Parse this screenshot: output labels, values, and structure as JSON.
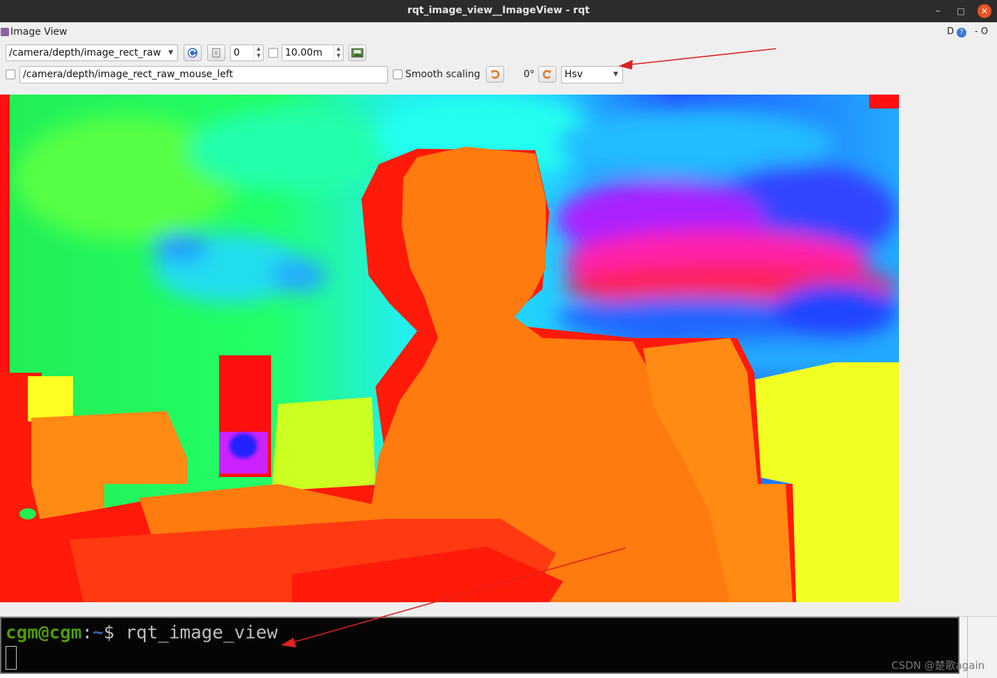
{
  "window": {
    "title": "rqt_image_view__ImageView - rqt",
    "minimize": "–",
    "maximize": "□",
    "close": "✕"
  },
  "dock": {
    "title": "Image View",
    "right_d": "D",
    "right_help": "?",
    "right_o": "- O"
  },
  "toolbar": {
    "topic": "/camera/depth/image_rect_raw",
    "min_value": "0",
    "max_value": "10.00m",
    "mouse_topic": "/camera/depth/image_rect_raw_mouse_left",
    "smooth_scaling_label": "Smooth scaling",
    "rotation": "0°",
    "colormap": "Hsv",
    "icons": [
      "refresh-icon",
      "zoom-fit-icon",
      "save-image-icon",
      "rotate-left-icon",
      "rotate-right-icon"
    ]
  },
  "terminal": {
    "user": "cgm@cgm",
    "colon": ":",
    "path": "~",
    "prompt": "$ ",
    "command": "rqt_image_view"
  },
  "watermark": "CSDN @楚歌again",
  "colors": {
    "titlebar": "#2c2c2c",
    "close": "#e95420",
    "annotation_arrow": "#e02020",
    "terminal_user": "#4e9a06",
    "terminal_path": "#3465a4"
  }
}
